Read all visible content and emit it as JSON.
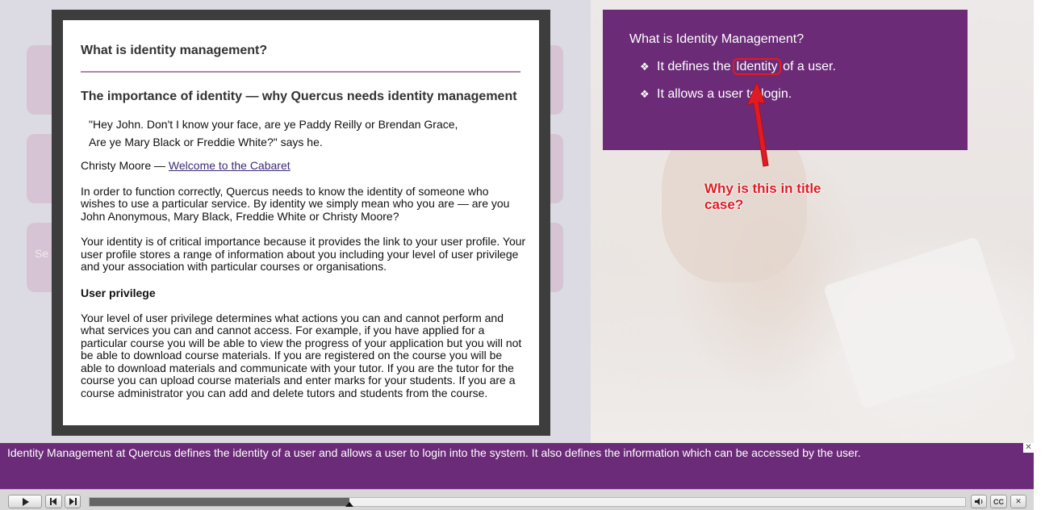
{
  "slide": {
    "ghost_label": "Se",
    "info_box": {
      "title": "What is Identity Management?",
      "bullets": [
        {
          "before": "It defines the ",
          "highlight": "Identity",
          "after": " of a user."
        },
        {
          "text": "It allows a user to login."
        }
      ],
      "bullet_glyph": "❖"
    },
    "annotation": {
      "text": "Why is this in title case?",
      "color": "#e01b24"
    }
  },
  "modal": {
    "title": "What is identity management?",
    "heading": "The importance of identity — why Quercus needs identity management",
    "quote_lines": [
      "\"Hey John. Don't I know your face, are ye Paddy Reilly or Brendan Grace,",
      "Are ye Mary Black or Freddie White?\" says he."
    ],
    "attribution_prefix": "Christy Moore — ",
    "attribution_link": "Welcome to the Cabaret",
    "para1": "In order to function correctly, Quercus needs to know the identity of someone who wishes to use a particular service. By identity we simply mean who you are — are you John Anonymous, Mary Black, Freddie White or Christy Moore?",
    "para2": "Your identity is of critical importance because it provides the link to your user profile. Your user profile stores a range of information about you including your level of user privilege and your association with particular courses or organisations.",
    "subheading": "User privilege",
    "para3": "Your level of user privilege determines what actions you can and cannot perform and what services you can and cannot access. For example, if you have applied for a particular course you will be able to view the progress of your application but you will not be able to download course materials. If you are registered on the course you will be able to download materials and communicate with your tutor. If you are the tutor for the course you can upload course materials and enter marks for your students. If you are a course administrator you can add and delete tutors and students from the course."
  },
  "caption": {
    "text": "Identity Management at Quercus defines the identity of a user and allows a user to login into the system. It also defines the information which can be accessed by the user.",
    "close_glyph": "✕"
  },
  "playbar": {
    "play_icon": "play-icon",
    "rewind_icon": "rewind-icon",
    "forward_icon": "forward-icon",
    "progress_fraction": 0.297,
    "volume_icon": "volume-icon",
    "cc_label": "CC",
    "close_glyph": "✕"
  },
  "colors": {
    "brand_purple": "#6b2b77",
    "annotation_red": "#e01b24"
  }
}
